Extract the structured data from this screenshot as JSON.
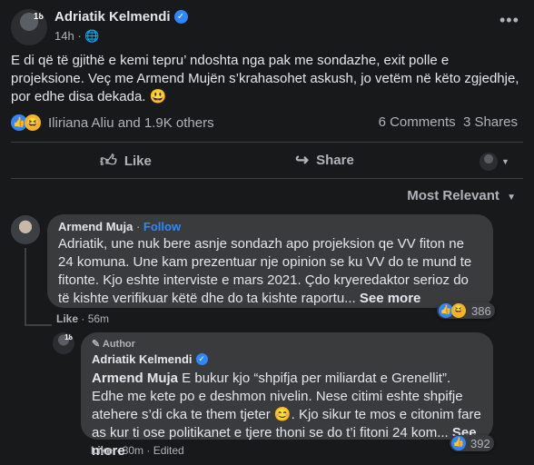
{
  "post": {
    "author": "Adriatik Kelmendi",
    "avatar_badge": "18",
    "time": "14h",
    "privacy_icon": "globe-icon",
    "text": "E di që të gjithë e kemi tepru’ ndoshta nga pak me sondazhe, exit polle e projeksione. Veç me Armend Mujën s’krahasohet askush, jo vetëm në këto zgjedhje, por edhe disa dekada. 😃",
    "reactions_text": "Iliriana Aliu and 1.9K others",
    "comments_count": "6 Comments",
    "shares_count": "3 Shares",
    "actions": {
      "like": "Like",
      "share": "Share"
    }
  },
  "sort": {
    "label": "Most Relevant"
  },
  "comments": [
    {
      "name": "Armend Muja",
      "follow": "Follow",
      "text": "Adriatik, une nuk bere asnje sondazh apo projeksion qe VV fiton ne 24 komuna. Une kam prezentuar nje opinion se ku VV do te mund te fitonte. Kjo eshte interviste e mars 2021. Çdo kryeredaktor serioz do të kishte verifikuar këtë dhe do ta kishte raportu...",
      "see_more": "See more",
      "like": "Like",
      "time": "56m",
      "reaction_count": "386"
    }
  ],
  "reply": {
    "author_label": "Author",
    "name": "Adriatik Kelmendi",
    "mention": "Armend Muja",
    "text": " E bukur kjo “shpifja per miliardat e Grenellit”. Edhe me kete po e deshmon nivelin. Nese citimi eshte shpifje atehere s’di cka te them tjeter 😊. Kjo sikur te mos e citonim fare as kur ti ose politikanet e tjere thoni se do t’i fitoni 24 kom...",
    "see_more": "See more",
    "like": "Like",
    "time": "30m",
    "edited": "Edited",
    "reaction_count": "392"
  },
  "colors": {
    "background": "#18191a",
    "bubble": "#3a3b3c",
    "link_blue": "#2d88ff",
    "secondary_text": "#b0b3b8"
  }
}
